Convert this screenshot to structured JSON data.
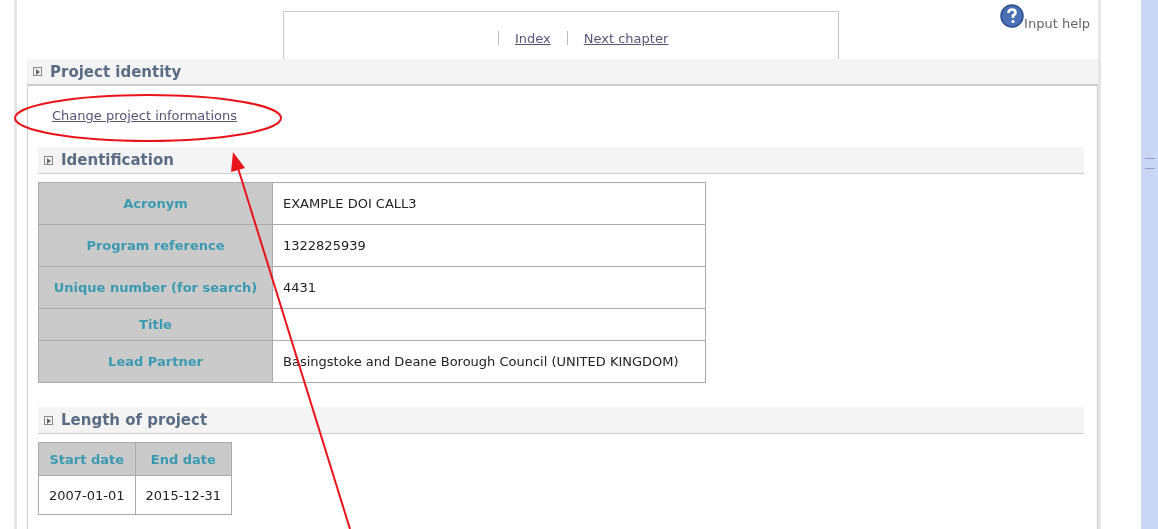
{
  "nav": {
    "links": [
      {
        "label": "Index"
      },
      {
        "label": "Next chapter"
      }
    ]
  },
  "help": {
    "label": "Input help"
  },
  "section": {
    "title": "Project identity",
    "link": "Change project informations",
    "identification": {
      "title": "Identification",
      "rows": [
        {
          "label": "Acronym",
          "value": "EXAMPLE DOI CALL3"
        },
        {
          "label": "Program reference",
          "value": "1322825939"
        },
        {
          "label": "Unique number (for search)",
          "value": "4431"
        },
        {
          "label": "Title"
        },
        {
          "label": "Lead Partner",
          "value": "Basingstoke and Deane Borough Council (UNITED KINGDOM)"
        }
      ]
    },
    "length": {
      "title": "Length of project",
      "columns": [
        "Start date",
        "End date"
      ],
      "values": [
        "2007-01-01",
        "2015-12-31"
      ]
    }
  }
}
